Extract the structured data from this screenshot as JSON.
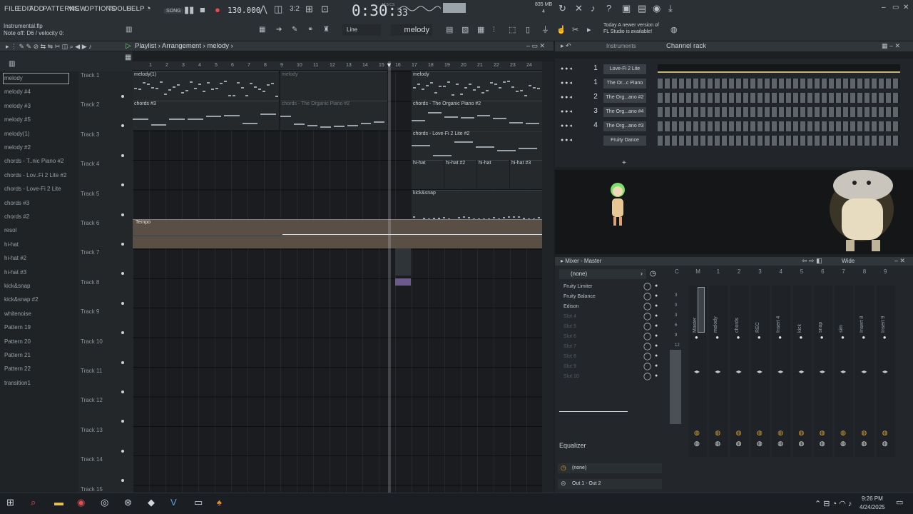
{
  "menu": [
    "FILE",
    "EDIT",
    "ADD",
    "PATTERNS",
    "VIEW",
    "OPTIONS",
    "TOOLS",
    "HELP"
  ],
  "mode": "SONG",
  "tempo": "130.000",
  "clock": {
    "main": "0:30",
    "sec": "33",
    "unit": "M:S:CS"
  },
  "cpu": {
    "mem": "835 MB",
    "polyphony": "4"
  },
  "hint": {
    "file": "Instrumental.flp",
    "status": "Note off: D6 / velocity 0:"
  },
  "news": {
    "line1": "Today  A newer version of",
    "line2": "FL Studio is available!"
  },
  "toolbar": {
    "snap": "Line",
    "pattern": "melody"
  },
  "playlist": {
    "title": "Playlist",
    "sub": "Arrangement",
    "pattern": "melody"
  },
  "picker": [
    "melody",
    "melody #4",
    "melody #3",
    "melody #5",
    "melody(1)",
    "melody #2",
    "chords - T..nic Piano #2",
    "chords - Lov..Fi 2 Lite #2",
    "chords - Love-Fi 2 Lite",
    "chords #3",
    "chords #2",
    "resol",
    "hi-hat",
    "hi-hat #2",
    "hi-hat #3",
    "kick&snap",
    "kick&snap #2",
    "whitenoise",
    "Pattern 19",
    "Pattern 20",
    "Pattern 21",
    "Pattern 22",
    "transition1"
  ],
  "ruler": [
    "1",
    "2",
    "3",
    "4",
    "5",
    "6",
    "7",
    "8",
    "9",
    "10",
    "11",
    "12",
    "13",
    "14",
    "15",
    "16",
    "17",
    "18",
    "19",
    "20",
    "21",
    "22",
    "23",
    "24",
    "25"
  ],
  "tracks": [
    "Track 1",
    "Track 2",
    "Track 3",
    "Track 4",
    "Track 5",
    "Track 6",
    "Track 7",
    "Track 8",
    "Track 9",
    "Track 10",
    "Track 11",
    "Track 12",
    "Track 13",
    "Track 14",
    "Track 15"
  ],
  "clips": {
    "m1": "melody(1)",
    "m2": "melody",
    "m3": "melody",
    "c1": "chords #3",
    "c2": "chords - The Organic Piano #2",
    "c3": "chords - The Organic Piano #2",
    "c4": "chords - Love-Fi 2 Lite #2",
    "h1": "hi-hat",
    "h2": "hi-hat #2",
    "h3": "hi-hat",
    "h4": "hi-hat #3",
    "k1": "kick&snap",
    "tempo": "Tempo"
  },
  "channel_rack": {
    "title": "Channel rack",
    "filter": "Instruments",
    "channels": [
      {
        "num": "1",
        "name": "Love-Fi 2 Lite"
      },
      {
        "num": "1",
        "name": "The Or...c Piano"
      },
      {
        "num": "2",
        "name": "The Org...ano #2"
      },
      {
        "num": "3",
        "name": "The Org...ano #4"
      },
      {
        "num": "4",
        "name": "The Org...ano #3"
      },
      {
        "num": "",
        "name": "Fruity Dance"
      }
    ]
  },
  "mixer": {
    "title": "Mixer - Master",
    "preset": "(none)",
    "view": "Wide",
    "slots": [
      "Fruity Limiter",
      "Fruity Balance",
      "Edison",
      "Slot 4",
      "Slot 5",
      "Slot 6",
      "Slot 7",
      "Slot 8",
      "Slot 9",
      "Slot 10"
    ],
    "eq": "Equalizer",
    "eq_preset": "(none)",
    "out": "Out 1 - Out 2",
    "headers": [
      "C",
      "M",
      "1",
      "2",
      "3",
      "4",
      "5",
      "6",
      "7",
      "8",
      "9"
    ],
    "strips": [
      "Master",
      "melody",
      "chords",
      "REC",
      "Insert 4",
      "kick",
      "snap",
      "sim",
      "Insert 8",
      "Insert 9"
    ],
    "scale": [
      "3",
      "0",
      "3",
      "6",
      "9",
      "12"
    ]
  },
  "taskbar": {
    "time": "9:26 PM",
    "date": "4/24/2025"
  }
}
